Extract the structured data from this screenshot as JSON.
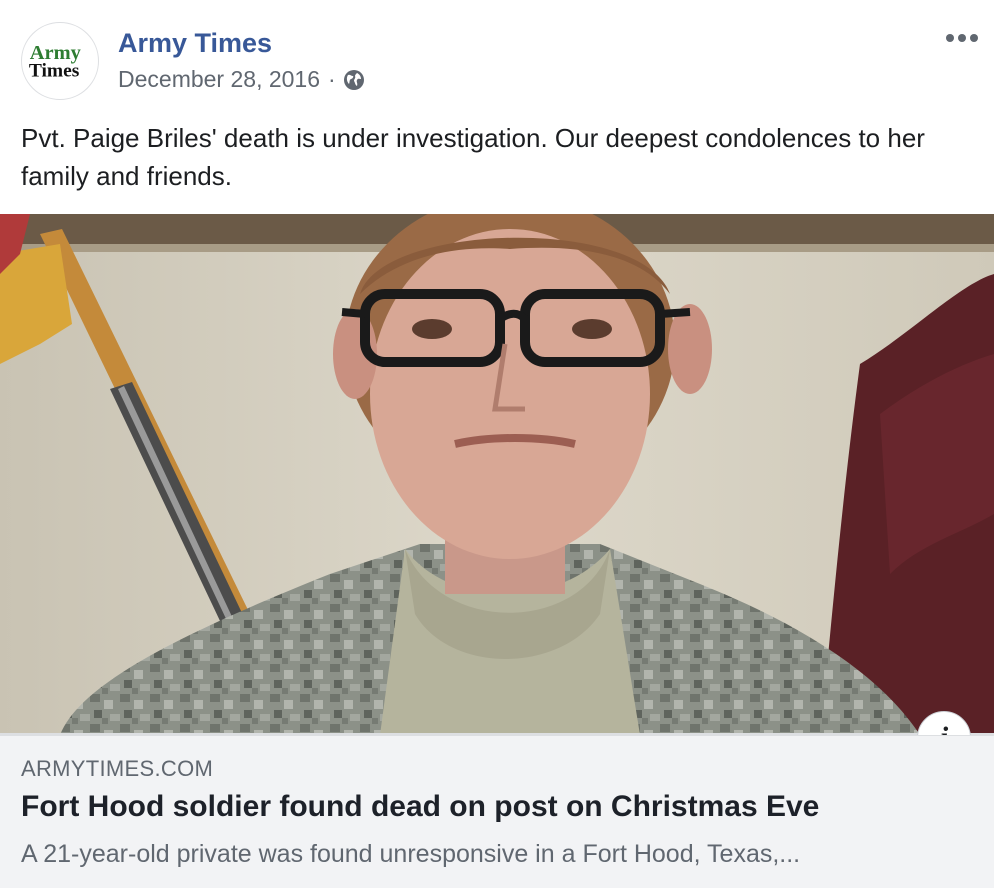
{
  "post": {
    "page_name": "Army Times",
    "avatar_logo_text": [
      "Army",
      "Times"
    ],
    "date": "December 28, 2016",
    "separator": "·",
    "privacy_icon": "globe-icon",
    "more_icon": "more-options-icon",
    "text": "Pvt. Paige Briles' death is under investigation. Our deepest condolences to her family and friends."
  },
  "link_preview": {
    "domain": "ARMYTIMES.COM",
    "headline": "Fort Hood soldier found dead on post on Christmas Eve",
    "description": "A 21-year-old private was found unresponsive in a Fort Hood, Texas,...",
    "info_icon_label": "i"
  },
  "colors": {
    "page_name": "#385898",
    "meta_text": "#606770",
    "link_bg": "#f2f3f5",
    "logo_green": "#2e7d32"
  }
}
